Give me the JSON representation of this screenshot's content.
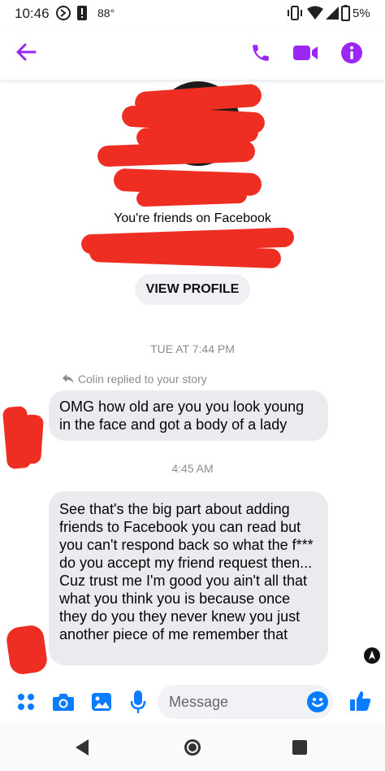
{
  "status_bar": {
    "time": "10:46",
    "temperature": "88°",
    "battery": "5%"
  },
  "header": {
    "back_icon": "arrow-left-icon",
    "actions": [
      "phone-icon",
      "video-icon",
      "info-icon"
    ],
    "accent_color": "#9b27f5"
  },
  "profile": {
    "friends_text": "You're friends on Facebook",
    "view_profile_label": "VIEW PROFILE"
  },
  "thread": {
    "timestamp_1": "TUE AT 7:44 PM",
    "reply_note": "Colin replied to your story",
    "message_1": "OMG how old are you you look young in the face and got a body of a lady",
    "timestamp_2": "4:45 AM",
    "message_2": "See that's the big part about adding friends to Facebook you can read but you can't respond back so what the f*** do you accept my friend request then... Cuz trust me I'm good you ain't all that what you think you is because once they do you they never knew you just another piece of me remember that"
  },
  "composer": {
    "placeholder": "Message",
    "tools": [
      "apps-icon",
      "camera-icon",
      "gallery-icon",
      "mic-icon",
      "emoji-icon",
      "thumbs-up-icon"
    ],
    "accent_color": "#0a7cff"
  },
  "nav": {
    "buttons": [
      "back-nav-icon",
      "home-nav-icon",
      "recents-nav-icon"
    ]
  }
}
